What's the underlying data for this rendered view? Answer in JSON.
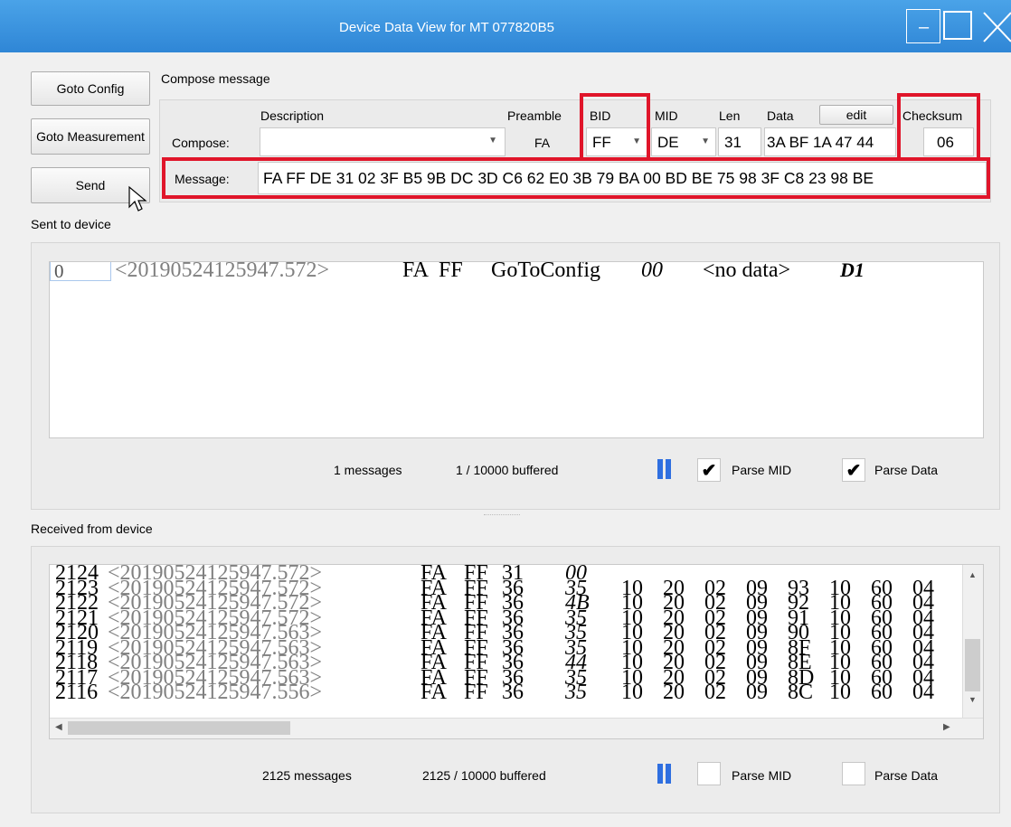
{
  "window": {
    "title": "Device Data View for MT 077820B5",
    "minimize": "–"
  },
  "buttons": {
    "goto_config": "Goto Config",
    "goto_measurement": "Goto Measurement",
    "send": "Send"
  },
  "compose": {
    "section_label": "Compose message",
    "headers": {
      "description": "Description",
      "preamble": "Preamble",
      "bid": "BID",
      "mid": "MID",
      "len": "Len",
      "data": "Data",
      "edit": "edit",
      "checksum": "Checksum"
    },
    "compose_label": "Compose:",
    "description_value": "",
    "preamble_value": "FA",
    "bid_value": "FF",
    "mid_value": "DE",
    "len_value": "31",
    "data_value": "3A BF 1A 47 44",
    "checksum_value": "06",
    "message_label": "Message:",
    "message_value": "FA FF DE 31 02 3F B5 9B DC 3D C6 62 E0 3B 79 BA 00 BD BE 75 98 3F C8 23 98 BE"
  },
  "sent": {
    "label": "Sent to device",
    "row": {
      "index": "0",
      "timestamp": "<20190524125947.572>",
      "pre": "FA",
      "bid": "FF",
      "mid": "GoToConfig",
      "len": "00",
      "data": "<no data>",
      "checksum": "D1"
    },
    "messages": "1 messages",
    "buffered": "1 / 10000 buffered",
    "parse_mid": "Parse MID",
    "parse_mid_checked": true,
    "parse_data": "Parse Data",
    "parse_data_checked": true
  },
  "received": {
    "label": "Received from device",
    "rows": [
      {
        "idx": "2124",
        "ts": "<20190524125947.572>",
        "pre": "FA",
        "bid": "FF",
        "mid": "31",
        "len": "00",
        "d": [
          "",
          "",
          "",
          "",
          "",
          "",
          "",
          ""
        ]
      },
      {
        "idx": "2123",
        "ts": "<20190524125947.572>",
        "pre": "FA",
        "bid": "FF",
        "mid": "36",
        "len": "35",
        "d": [
          "10",
          "20",
          "02",
          "09",
          "93",
          "10",
          "60",
          "04"
        ]
      },
      {
        "idx": "2122",
        "ts": "<20190524125947.572>",
        "pre": "FA",
        "bid": "FF",
        "mid": "36",
        "len": "4B",
        "d": [
          "10",
          "20",
          "02",
          "09",
          "92",
          "10",
          "60",
          "04"
        ]
      },
      {
        "idx": "2121",
        "ts": "<20190524125947.572>",
        "pre": "FA",
        "bid": "FF",
        "mid": "36",
        "len": "35",
        "d": [
          "10",
          "20",
          "02",
          "09",
          "91",
          "10",
          "60",
          "04"
        ]
      },
      {
        "idx": "2120",
        "ts": "<20190524125947.563>",
        "pre": "FA",
        "bid": "FF",
        "mid": "36",
        "len": "35",
        "d": [
          "10",
          "20",
          "02",
          "09",
          "90",
          "10",
          "60",
          "04"
        ]
      },
      {
        "idx": "2119",
        "ts": "<20190524125947.563>",
        "pre": "FA",
        "bid": "FF",
        "mid": "36",
        "len": "35",
        "d": [
          "10",
          "20",
          "02",
          "09",
          "8F",
          "10",
          "60",
          "04"
        ]
      },
      {
        "idx": "2118",
        "ts": "<20190524125947.563>",
        "pre": "FA",
        "bid": "FF",
        "mid": "36",
        "len": "44",
        "d": [
          "10",
          "20",
          "02",
          "09",
          "8E",
          "10",
          "60",
          "04"
        ]
      },
      {
        "idx": "2117",
        "ts": "<20190524125947.563>",
        "pre": "FA",
        "bid": "FF",
        "mid": "36",
        "len": "35",
        "d": [
          "10",
          "20",
          "02",
          "09",
          "8D",
          "10",
          "60",
          "04"
        ]
      },
      {
        "idx": "2116",
        "ts": "<20190524125947.556>",
        "pre": "FA",
        "bid": "FF",
        "mid": "36",
        "len": "35",
        "d": [
          "10",
          "20",
          "02",
          "09",
          "8C",
          "10",
          "60",
          "04"
        ]
      }
    ],
    "messages": "2125 messages",
    "buffered": "2125 / 10000 buffered",
    "parse_mid": "Parse MID",
    "parse_mid_checked": false,
    "parse_data": "Parse Data",
    "parse_data_checked": false
  },
  "colors": {
    "titlebar": "#2f86d6",
    "highlight": "#e0152a",
    "pause": "#2f6fe0"
  }
}
